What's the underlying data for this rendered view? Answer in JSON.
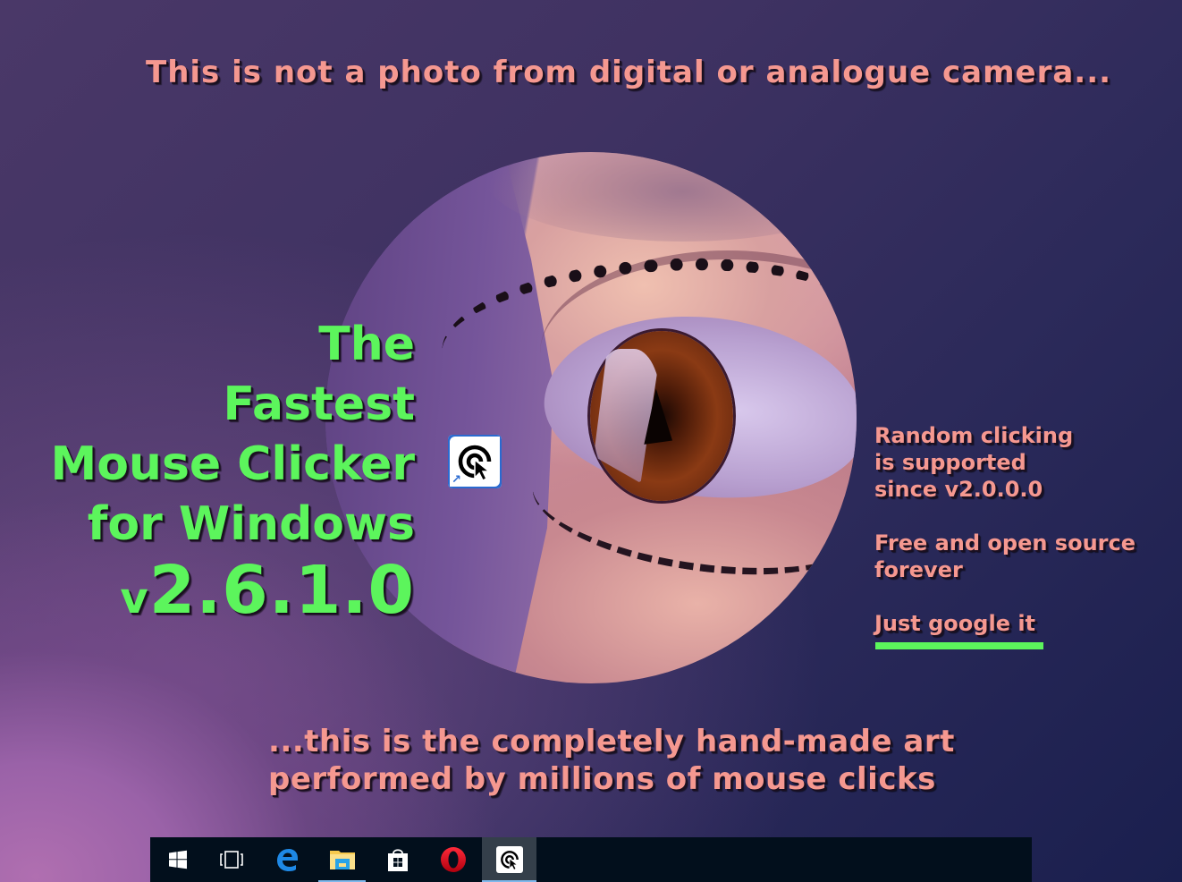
{
  "captions": {
    "top": "This is not a photo from digital or analogue camera...",
    "bottom_line1": "...this is the completely hand-made art",
    "bottom_line2": "performed by millions of mouse clicks"
  },
  "title": {
    "line1": "The",
    "line2": "Fastest",
    "line3": "Mouse Clicker",
    "line4": "for Windows",
    "version_prefix": "v",
    "version_number": "2.6.1.0"
  },
  "side_notes": {
    "random_line1": "Random clicking",
    "random_line2": "is supported",
    "random_line3": "since v2.0.0.0",
    "open_line1": "Free and open source",
    "open_line2": "forever",
    "google": "Just google it"
  },
  "artwork": {
    "subject": "close-up eye illustration"
  },
  "desktop_icon": {
    "icon": "mouse-clicker-target-cursor-icon",
    "shortcut_overlay": "shortcut-arrow-icon"
  },
  "colors": {
    "caption_pink": "#f59890",
    "title_green": "#5cf55c",
    "taskbar_bg": "#020f1c",
    "taskbar_active_bg": "#343f4a",
    "taskbar_indicator": "#7fb8ec"
  },
  "taskbar": {
    "items": [
      {
        "name": "start",
        "icon": "windows-logo-icon",
        "running": false,
        "active": false
      },
      {
        "name": "task-view",
        "icon": "task-view-icon",
        "running": false,
        "active": false
      },
      {
        "name": "edge",
        "icon": "edge-browser-icon",
        "running": false,
        "active": false
      },
      {
        "name": "file-explorer",
        "icon": "folder-icon",
        "running": true,
        "active": false
      },
      {
        "name": "store",
        "icon": "store-bag-icon",
        "running": false,
        "active": false
      },
      {
        "name": "opera",
        "icon": "opera-browser-icon",
        "running": false,
        "active": false
      },
      {
        "name": "mouse-clicker",
        "icon": "mouse-clicker-target-cursor-icon",
        "running": true,
        "active": true
      }
    ]
  }
}
